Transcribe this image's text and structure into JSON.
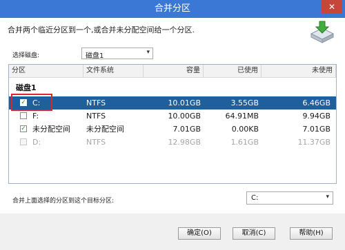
{
  "window": {
    "title": "合并分区",
    "close_glyph": "✕"
  },
  "header": {
    "instruction": "合并两个临近分区到一个,或合并未分配空间给一个分区."
  },
  "disk_select": {
    "label": "选择磁盘:",
    "value": "磁盘1"
  },
  "table": {
    "columns": [
      "分区",
      "文件系统",
      "容量",
      "已使用",
      "未使用"
    ],
    "group": "磁盘1",
    "rows": [
      {
        "name": "C:",
        "fs": "NTFS",
        "capacity": "10.01GB",
        "used": "3.55GB",
        "free": "6.46GB",
        "checked": true,
        "selected": true,
        "disabled": false
      },
      {
        "name": "F:",
        "fs": "NTFS",
        "capacity": "10.00GB",
        "used": "64.91MB",
        "free": "9.94GB",
        "checked": false,
        "selected": false,
        "disabled": false
      },
      {
        "name": "未分配空间",
        "fs": "未分配空间",
        "capacity": "7.01GB",
        "used": "0.00KB",
        "free": "7.01GB",
        "checked": true,
        "selected": false,
        "disabled": false
      },
      {
        "name": "D:",
        "fs": "NTFS",
        "capacity": "12.98GB",
        "used": "1.61GB",
        "free": "11.37GB",
        "checked": false,
        "selected": false,
        "disabled": true
      }
    ],
    "check_glyph": "✓"
  },
  "target": {
    "label": "合并上面选择的分区到这个目标分区:",
    "value": "C:"
  },
  "buttons": {
    "ok": "确定(O)",
    "cancel": "取消(C)",
    "help": "帮助(H)"
  },
  "icons": {
    "app": "merge-disk-icon",
    "chevron": "▾"
  },
  "colors": {
    "titlebar": "#3b78d6",
    "selected_row": "#1f5f9c",
    "highlight": "#d9262a",
    "check": "#2e8b3a"
  }
}
